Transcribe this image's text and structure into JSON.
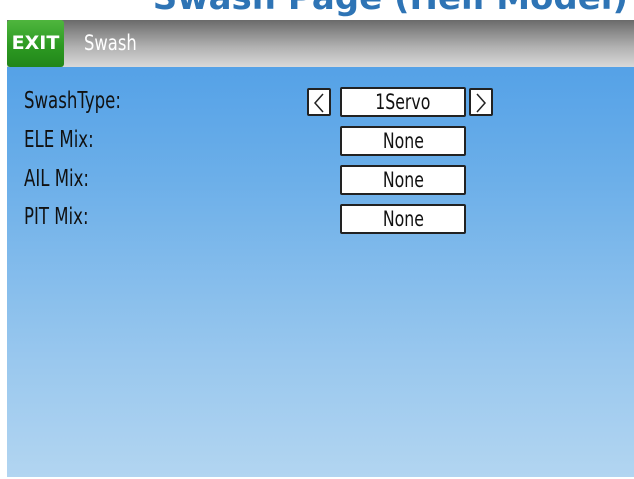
{
  "page_heading": "Swash Page (Heli Model)",
  "titlebar": {
    "exit_label": "EXIT",
    "title": "Swash"
  },
  "rows": [
    {
      "label": "SwashType:",
      "value": "1Servo"
    },
    {
      "label": "ELE Mix:",
      "value": "None"
    },
    {
      "label": "AIL Mix:",
      "value": "None"
    },
    {
      "label": "PIT Mix:",
      "value": "None"
    }
  ],
  "icons": {
    "prev": "chevron-left-icon",
    "next": "chevron-right-icon"
  },
  "colors": {
    "heading": "#2e74b5",
    "exit_button": "#2d9a22",
    "background_top": "#4b9ce6",
    "background_bottom": "#b2d5f1"
  }
}
